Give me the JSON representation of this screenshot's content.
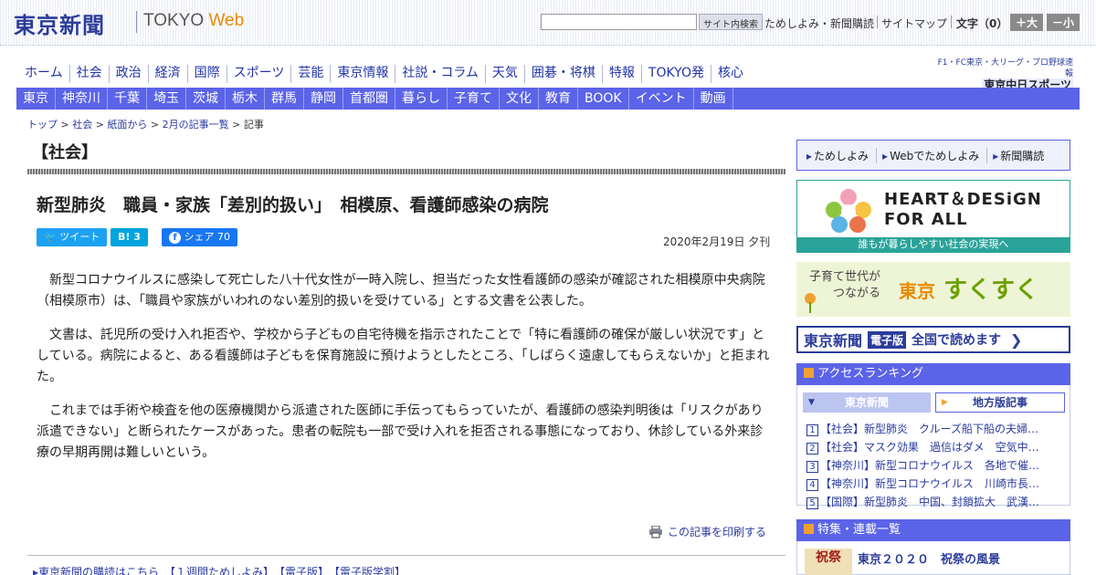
{
  "header": {
    "logo_jp": "東京新聞",
    "logo_en_main": "TOKYO ",
    "logo_en_web": "Web",
    "search_button": "サイト内検索",
    "links": [
      "ためしよみ・新聞購読",
      "サイトマップ"
    ],
    "font_size_label": "文字（0）",
    "font_larger": "＋大",
    "font_smaller": "－小"
  },
  "global_nav": [
    "ホーム",
    "社会",
    "政治",
    "経済",
    "国際",
    "スポーツ",
    "芸能",
    "東京情報",
    "社説・コラム",
    "天気",
    "囲碁・将棋",
    "特報",
    "TOKYO発",
    "核心"
  ],
  "sports_badge": {
    "line1": "F1・FC東京・大リーグ・プロ野球速報",
    "line2": "東京中日スポーツ"
  },
  "area_nav": [
    "東京",
    "神奈川",
    "千葉",
    "埼玉",
    "茨城",
    "栃木",
    "群馬",
    "静岡",
    "首都圏",
    "暮らし",
    "子育て",
    "文化",
    "教育",
    "BOOK",
    "イベント",
    "動画"
  ],
  "breadcrumb": [
    "トップ",
    "社会",
    "紙面から",
    "2月の記事一覧",
    "記事"
  ],
  "article": {
    "section": "【社会】",
    "headline": "新型肺炎　職員・家族「差別的扱い」　相模原、看護師感染の病院",
    "share_tweet": "ツイート",
    "share_hatena": "B! 3",
    "share_fb": "シェア 70",
    "date": "2020年2月19日 夕刊",
    "paragraphs": [
      "新型コロナウイルスに感染して死亡した八十代女性が一時入院し、担当だった女性看護師の感染が確認された相模原中央病院（相模原市）は、「職員や家族がいわれのない差別的扱いを受けている」とする文書を公表した。",
      "文書は、託児所の受け入れ拒否や、学校から子どもの自宅待機を指示されたことで「特に看護師の確保が厳しい状況です」としている。病院によると、ある看護師は子どもを保育施設に預けようとしたところ、「しばらく遠慮してもらえないか」と拒まれた。",
      "これまでは手術や検査を他の医療機関から派遣された医師に手伝ってもらっていたが、看護師の感染判明後は「リスクがあり派遣できない」と断られたケースがあった。患者の転院も一部で受け入れを拒否される事態になっており、休診している外来診療の早期再開は難しいという。"
    ],
    "print_link": "この記事を印刷する",
    "bottom_links": "▸東京新聞の購読はこちら　【１週間ためしよみ】　【電子版】　【電子版学割】"
  },
  "sidebar": {
    "tameshi": [
      "ためしよみ",
      "Webでためしよみ",
      "新聞購読"
    ],
    "heart_title_1": "HEART＆DESiGN",
    "heart_title_2": "FOR ALL",
    "heart_sub": "誰もが暮らしやすい社会の実現へ",
    "suku_small_1": "子育て世代が",
    "suku_small_2": "つながる",
    "suku_tokyo": "東京",
    "suku_big": "すくすく",
    "denshi_logo": "東京新聞",
    "denshi_badge": "電子版",
    "denshi_text": "全国で読めます",
    "ranking_title": "アクセスランキング",
    "ranking_tab_active": "東京新聞",
    "ranking_tab_inactive": "地方版記事",
    "ranking": [
      {
        "num": "1",
        "text": "【社会】新型肺炎　クルーズ船下船の夫婦…"
      },
      {
        "num": "2",
        "text": "【社会】マスク効果　過信はダメ　空気中…"
      },
      {
        "num": "3",
        "text": "【神奈川】新型コロナウイルス　各地で催…"
      },
      {
        "num": "4",
        "text": "【神奈川】新型コロナウイルス　川崎市長…"
      },
      {
        "num": "5",
        "text": "【国際】新型肺炎　中国、封鎖拡大　武漢…"
      }
    ],
    "feature_title": "特集・連載一覧",
    "feature_thumb": "祝祭",
    "feature_item": "東京２０２０　祝祭の風景"
  },
  "colors": {
    "brand_blue": "#2c3c9a",
    "nav_bar": "#5b63e8",
    "accent_orange": "#f0a030",
    "heart_teal": "#2aa39a"
  }
}
